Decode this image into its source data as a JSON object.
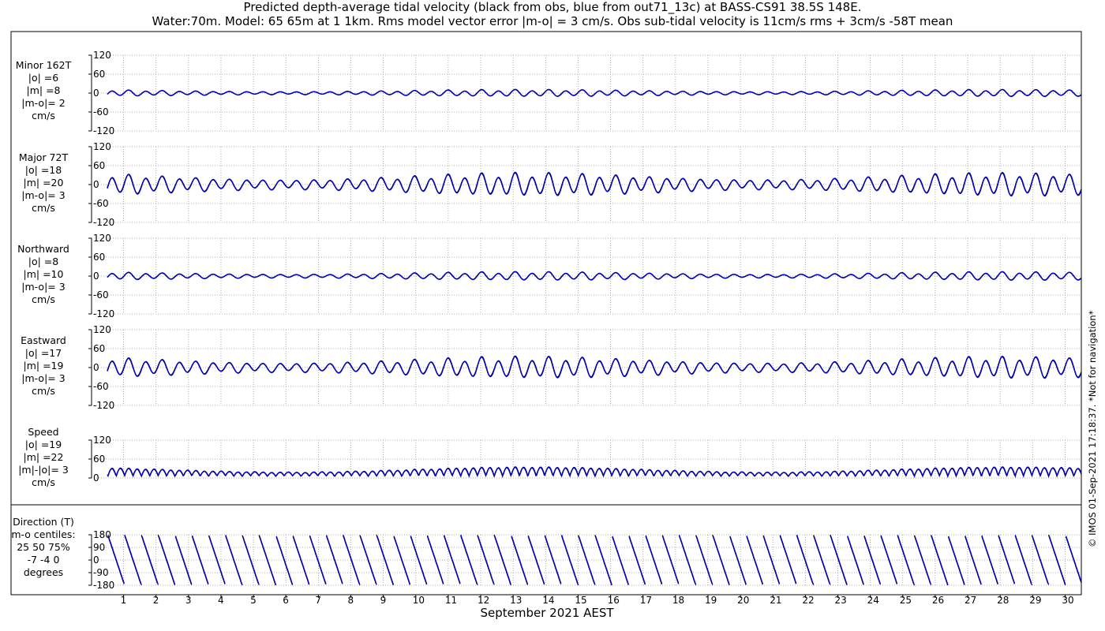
{
  "title_line1": "Predicted depth-average tidal velocity (black from obs, blue from out71_13c) at BASS-CS91 38.5S 148E.",
  "title_line2": "Water:70m. Model: 65 65m at 1 1km. Rms model vector error |m-o| = 3 cm/s. Obs sub-tidal velocity is 11cm/s rms + 3cm/s -58T mean",
  "xlabel": "September 2021 AEST",
  "footer": "© IMOS 01-Sep-2021 17:18:37. *Not for navigation*",
  "colors": {
    "obs": "#000000",
    "model": "#0000cc",
    "grid": "#999999"
  },
  "panels": [
    {
      "id": "minor",
      "labels": [
        "Minor 162T",
        "|o| =6",
        "|m| =8",
        "|m-o|= 2",
        "cm/s"
      ]
    },
    {
      "id": "major",
      "labels": [
        "Major 72T",
        "|o| =18",
        "|m| =20",
        "|m-o|= 3",
        "cm/s"
      ]
    },
    {
      "id": "north",
      "labels": [
        "Northward",
        "|o| =8",
        "|m| =10",
        "|m-o|= 3",
        "cm/s"
      ]
    },
    {
      "id": "east",
      "labels": [
        "Eastward",
        "|o| =17",
        "|m| =19",
        "|m-o|= 3",
        "cm/s"
      ]
    },
    {
      "id": "speed",
      "labels": [
        "Speed",
        "|o| =19",
        "|m| =22",
        "|m|-|o|= 3",
        "cm/s"
      ]
    },
    {
      "id": "dir",
      "labels": [
        "Direction (T)",
        "m-o centiles:",
        "25  50  75%",
        "-7 -4  0",
        "degrees"
      ]
    }
  ],
  "chart_data": [
    {
      "type": "line",
      "name": "minor",
      "ylim": [
        -120,
        120
      ],
      "yticks": [
        120,
        60,
        0,
        -60,
        -120
      ],
      "xlim": [
        0.5,
        30.5
      ],
      "xticks": [
        1,
        2,
        3,
        4,
        5,
        6,
        7,
        8,
        9,
        10,
        11,
        12,
        13,
        14,
        15,
        16,
        17,
        18,
        19,
        20,
        21,
        22,
        23,
        24,
        25,
        26,
        27,
        28,
        29,
        30
      ],
      "series": [],
      "amplitude_approx": 9,
      "grid": true
    },
    {
      "type": "line",
      "name": "major",
      "ylim": [
        -120,
        120
      ],
      "yticks": [
        120,
        60,
        0,
        -60,
        -120
      ],
      "xlim": [
        0.5,
        30.5
      ],
      "xticks": [
        1,
        2,
        3,
        4,
        5,
        6,
        7,
        8,
        9,
        10,
        11,
        12,
        13,
        14,
        15,
        16,
        17,
        18,
        19,
        20,
        21,
        22,
        23,
        24,
        25,
        26,
        27,
        28,
        29,
        30
      ],
      "series": [],
      "amplitude_approx": 30,
      "grid": true
    },
    {
      "type": "line",
      "name": "north",
      "ylim": [
        -120,
        120
      ],
      "yticks": [
        120,
        60,
        0,
        -60,
        -120
      ],
      "xlim": [
        0.5,
        30.5
      ],
      "xticks": [
        1,
        2,
        3,
        4,
        5,
        6,
        7,
        8,
        9,
        10,
        11,
        12,
        13,
        14,
        15,
        16,
        17,
        18,
        19,
        20,
        21,
        22,
        23,
        24,
        25,
        26,
        27,
        28,
        29,
        30
      ],
      "series": [],
      "amplitude_approx": 11,
      "grid": true
    },
    {
      "type": "line",
      "name": "east",
      "ylim": [
        -120,
        120
      ],
      "yticks": [
        120,
        60,
        0,
        -60,
        -120
      ],
      "xlim": [
        0.5,
        30.5
      ],
      "xticks": [
        1,
        2,
        3,
        4,
        5,
        6,
        7,
        8,
        9,
        10,
        11,
        12,
        13,
        14,
        15,
        16,
        17,
        18,
        19,
        20,
        21,
        22,
        23,
        24,
        25,
        26,
        27,
        28,
        29,
        30
      ],
      "series": [],
      "amplitude_approx": 28,
      "grid": true
    },
    {
      "type": "line",
      "name": "speed",
      "ylim": [
        0,
        120
      ],
      "yticks": [
        120,
        60,
        0
      ],
      "xlim": [
        0.5,
        30.5
      ],
      "xticks": [
        1,
        2,
        3,
        4,
        5,
        6,
        7,
        8,
        9,
        10,
        11,
        12,
        13,
        14,
        15,
        16,
        17,
        18,
        19,
        20,
        21,
        22,
        23,
        24,
        25,
        26,
        27,
        28,
        29,
        30
      ],
      "series": [],
      "amplitude_approx": 30,
      "grid": true
    },
    {
      "type": "line",
      "name": "direction",
      "ylim": [
        -180,
        180
      ],
      "yticks": [
        180,
        90,
        0,
        -90,
        -180
      ],
      "xlim": [
        0.5,
        30.5
      ],
      "xticks": [
        1,
        2,
        3,
        4,
        5,
        6,
        7,
        8,
        9,
        10,
        11,
        12,
        13,
        14,
        15,
        16,
        17,
        18,
        19,
        20,
        21,
        22,
        23,
        24,
        25,
        26,
        27,
        28,
        29,
        30
      ],
      "series": [],
      "grid": true
    }
  ]
}
